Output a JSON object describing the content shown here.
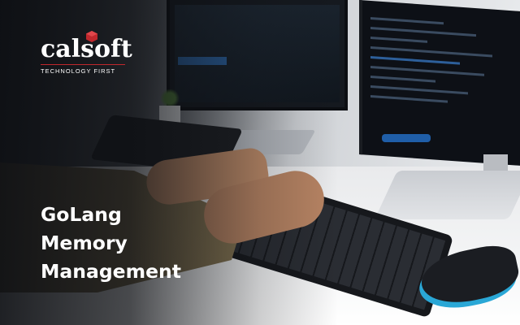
{
  "brand": {
    "wordmark": "calsoft",
    "tagline": "TECHNOLOGY FIRST",
    "accent_color": "#c0282d",
    "mark_icon": "red-cube-logo-icon"
  },
  "headline": {
    "lines": [
      "GoLang",
      "Memory",
      "Management"
    ]
  },
  "scene": {
    "description_icons": [
      "monitor-icon",
      "keyboard-icon",
      "mouse-icon",
      "plant-icon"
    ],
    "mouse_accent_color": "#2aa7d6"
  }
}
